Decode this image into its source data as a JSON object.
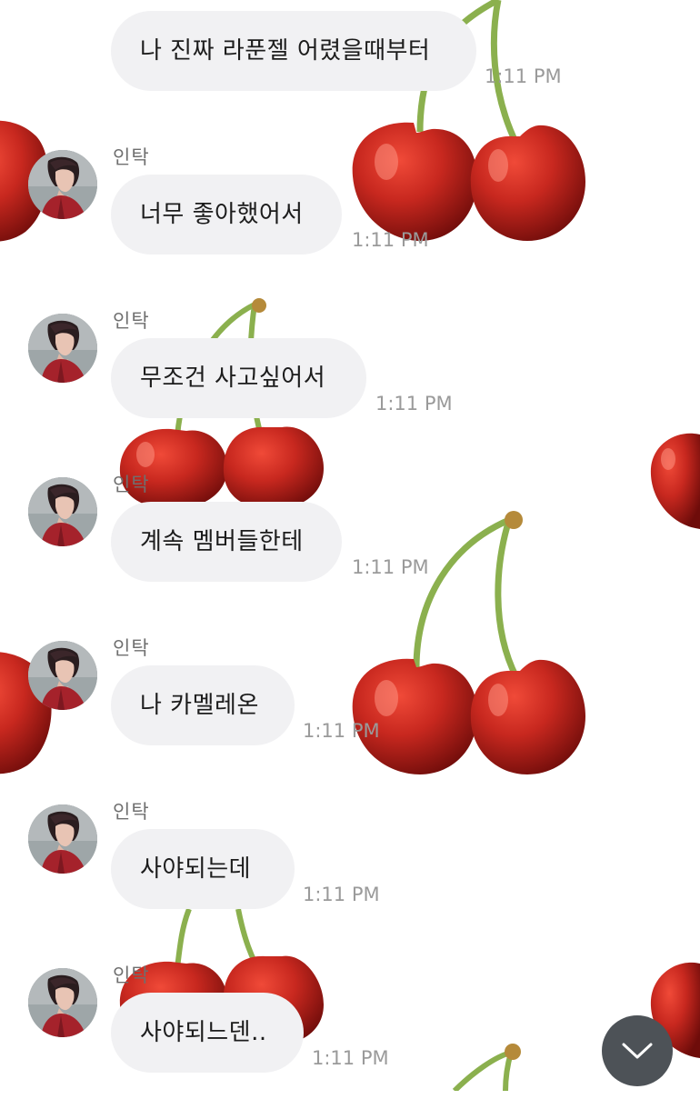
{
  "chat": {
    "messages": [
      {
        "sender": "",
        "text": "나 진짜 라푼젤 어렸을때부터",
        "time": "1:11 PM",
        "avatar": false
      },
      {
        "sender": "인탁",
        "text": "너무 좋아했어서",
        "time": "1:11 PM",
        "avatar": true
      },
      {
        "sender": "인탁",
        "text": "무조건 사고싶어서",
        "time": "1:11 PM",
        "avatar": true
      },
      {
        "sender": "인탁",
        "text": "계속 멤버들한테",
        "time": "1:11 PM",
        "avatar": true
      },
      {
        "sender": "인탁",
        "text": "나 카멜레온",
        "time": "1:11 PM",
        "avatar": true
      },
      {
        "sender": "인탁",
        "text": "사야되는데",
        "time": "1:11 PM",
        "avatar": true
      },
      {
        "sender": "인탁",
        "text": "사야되느덴..",
        "time": "1:11 PM",
        "avatar": true
      }
    ]
  },
  "scroll_button": {
    "icon": "chevron-down-icon"
  },
  "background": {
    "decoration": "cherry-pattern"
  },
  "colors": {
    "bubble": "#f1f1f3",
    "cherry": "#c8281f",
    "stem": "#8bb04e",
    "scroll_button": "#4d5257"
  }
}
